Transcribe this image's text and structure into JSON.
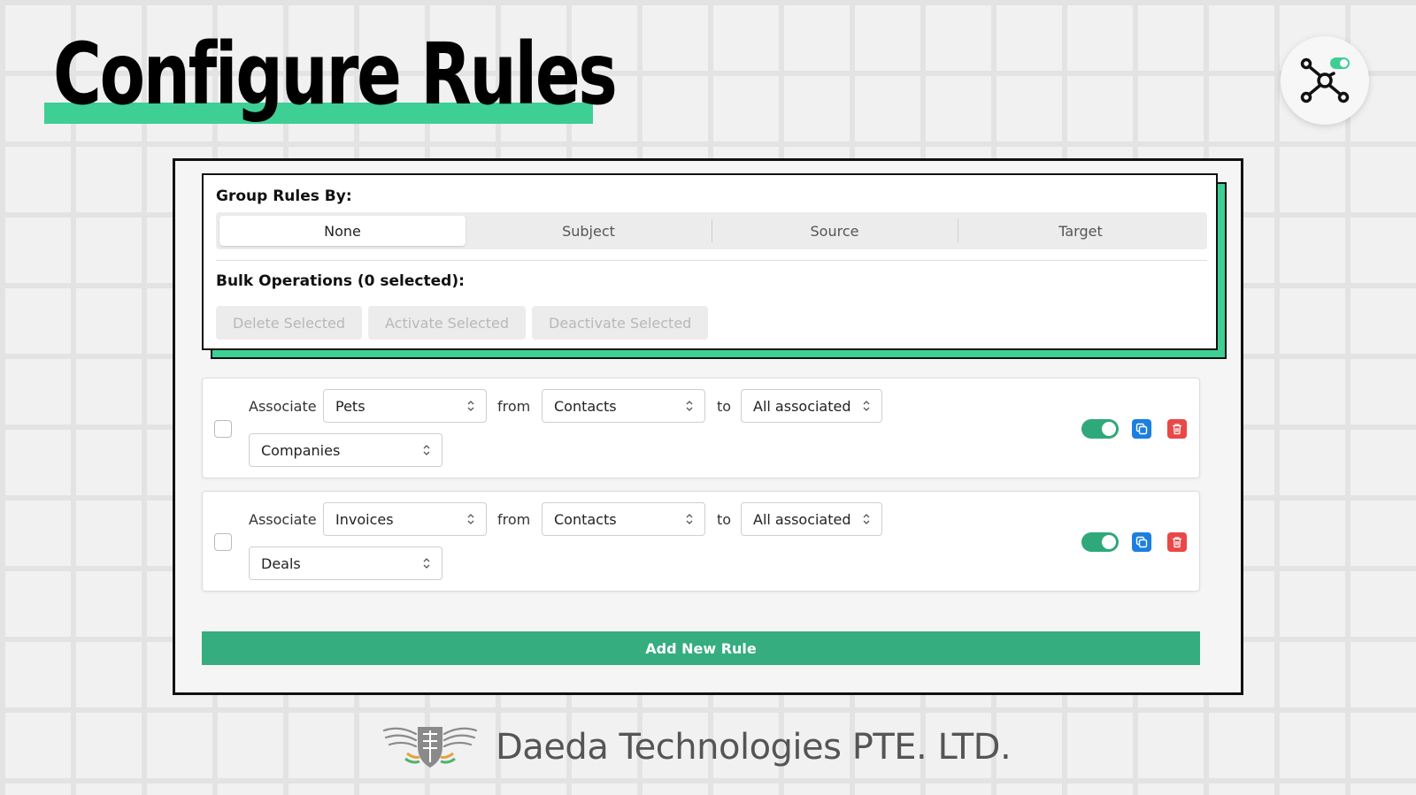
{
  "title": "Configure Rules",
  "group_rules": {
    "label": "Group Rules By:",
    "options": [
      "None",
      "Subject",
      "Source",
      "Target"
    ],
    "selected": "None"
  },
  "bulk": {
    "label": "Bulk Operations (0 selected):",
    "delete": "Delete Selected",
    "activate": "Activate Selected",
    "deactivate": "Deactivate Selected"
  },
  "rule_words": {
    "associate": "Associate",
    "from": "from",
    "to": "to"
  },
  "rules": [
    {
      "object": "Pets",
      "source": "Contacts",
      "scope": "All associated",
      "target": "Companies",
      "active": true
    },
    {
      "object": "Invoices",
      "source": "Contacts",
      "scope": "All associated",
      "target": "Deals",
      "active": true
    }
  ],
  "add_rule": "Add New Rule",
  "brand": "Daeda Technologies PTE. LTD.",
  "colors": {
    "accent": "#3ecf94",
    "primary_button": "#35ad7f",
    "copy": "#1b7fe0",
    "delete": "#ea4747"
  },
  "icons": {
    "app_badge": "network-toggle-icon",
    "copy": "copy-icon",
    "delete": "trash-icon",
    "brand": "winged-shield-logo"
  }
}
